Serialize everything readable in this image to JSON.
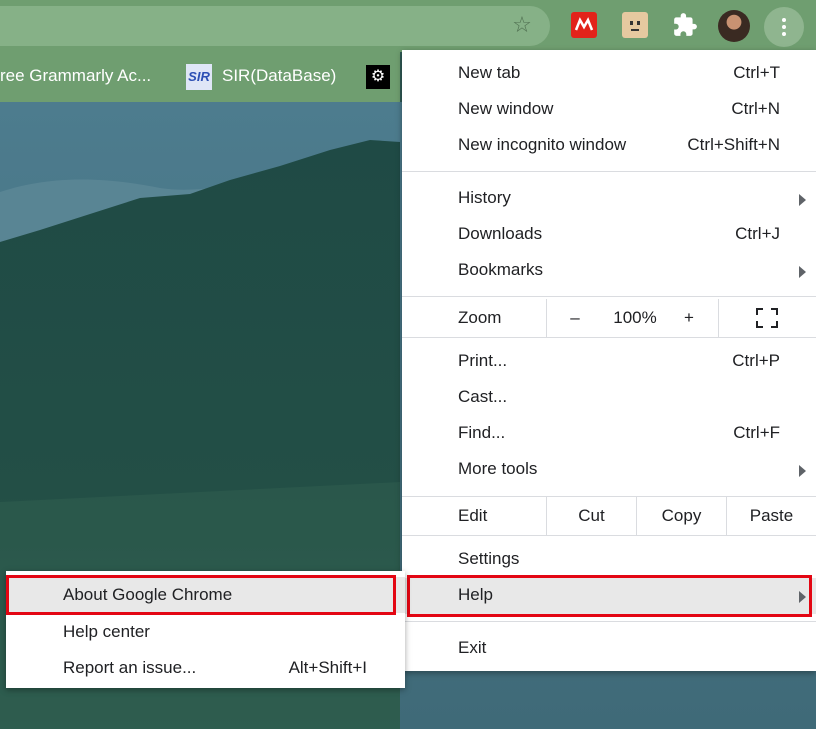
{
  "bookmarks": {
    "items": [
      {
        "label": "ree Grammarly Ac..."
      },
      {
        "label": "SIR(DataBase)",
        "icon_text": "SIR"
      }
    ]
  },
  "menu": {
    "new_tab": {
      "label": "New tab",
      "shortcut": "Ctrl+T"
    },
    "new_window": {
      "label": "New window",
      "shortcut": "Ctrl+N"
    },
    "new_incognito": {
      "label": "New incognito window",
      "shortcut": "Ctrl+Shift+N"
    },
    "history": {
      "label": "History"
    },
    "downloads": {
      "label": "Downloads",
      "shortcut": "Ctrl+J"
    },
    "bookmarks": {
      "label": "Bookmarks"
    },
    "zoom": {
      "label": "Zoom",
      "minus": "–",
      "value": "100%",
      "plus": "+"
    },
    "print": {
      "label": "Print...",
      "shortcut": "Ctrl+P"
    },
    "cast": {
      "label": "Cast..."
    },
    "find": {
      "label": "Find...",
      "shortcut": "Ctrl+F"
    },
    "more_tools": {
      "label": "More tools"
    },
    "edit": {
      "label": "Edit",
      "cut": "Cut",
      "copy": "Copy",
      "paste": "Paste"
    },
    "settings": {
      "label": "Settings"
    },
    "help": {
      "label": "Help"
    },
    "exit": {
      "label": "Exit"
    }
  },
  "help_submenu": {
    "about": {
      "label": "About Google Chrome"
    },
    "help_center": {
      "label": "Help center"
    },
    "report": {
      "label": "Report an issue...",
      "shortcut": "Alt+Shift+I"
    }
  },
  "colors": {
    "chrome_frame": "#6f9e70",
    "highlight_border": "#e30613",
    "hover_bg": "#e8e8e8"
  },
  "icons": [
    "star-icon",
    "extension-red-icon",
    "extension-tan-icon",
    "puzzle-icon",
    "avatar",
    "more-vert-icon",
    "gear-icon",
    "fullscreen-icon",
    "submenu-arrow-icon"
  ]
}
